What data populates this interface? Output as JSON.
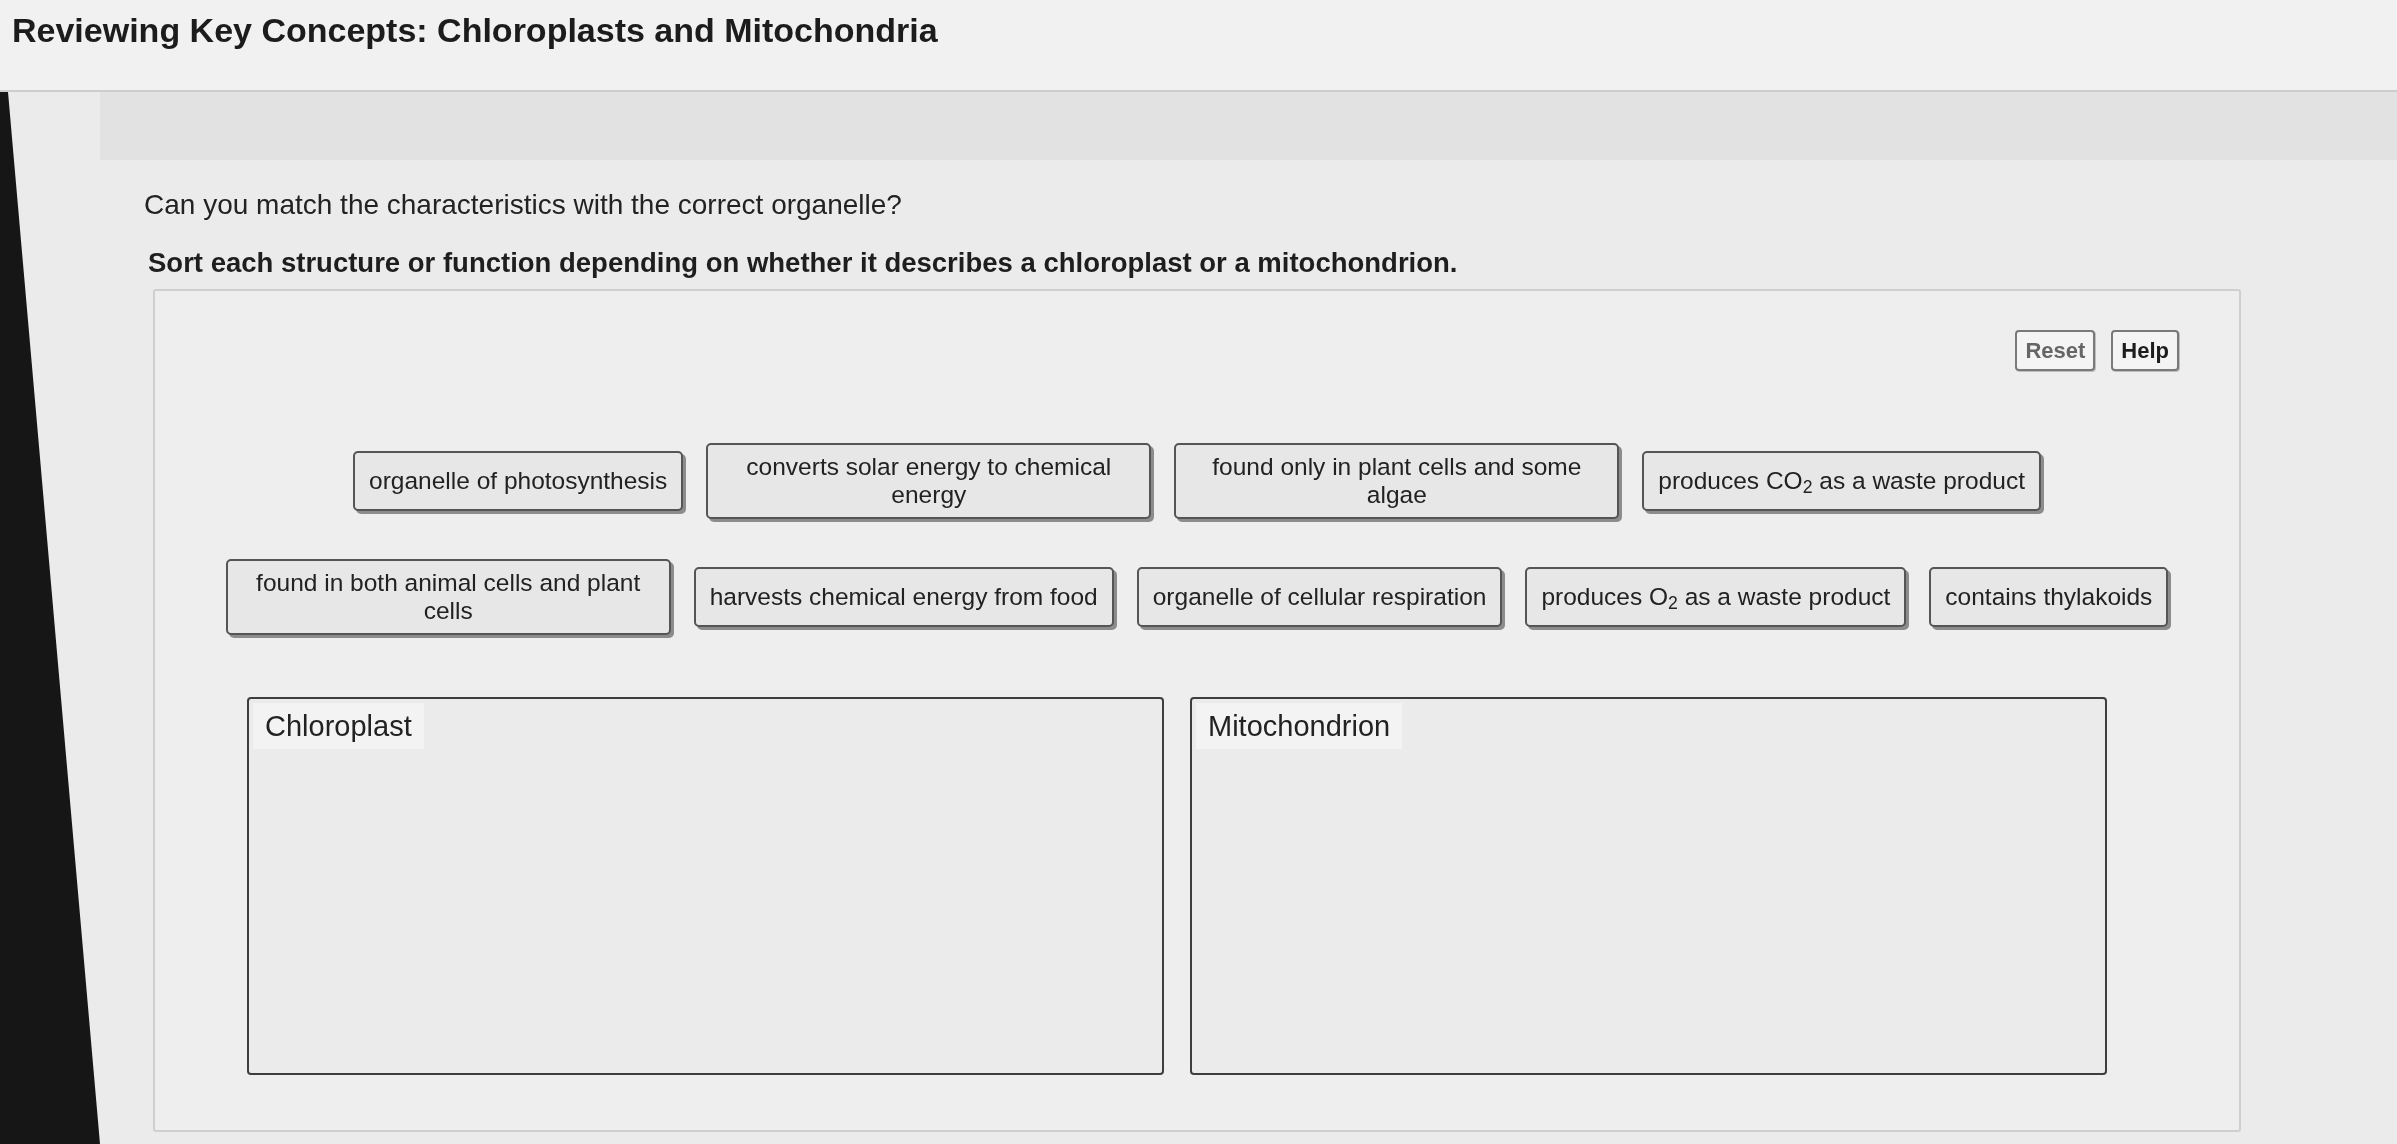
{
  "title": "Reviewing Key Concepts: Chloroplasts and Mitochondria",
  "question": "Can you match the characteristics with the correct organelle?",
  "instruction": "Sort each structure or function depending on whether it describes a chloroplast or a mitochondrion.",
  "buttons": [
    {
      "label": "Reset",
      "disabled": true
    },
    {
      "label": "Help",
      "disabled": false
    }
  ],
  "tiles": [
    "organelle of photosynthesis",
    "converts solar energy to chemical energy",
    "found only in plant cells and some algae",
    "produces CO$_{2}$ as a waste product",
    "found in both animal cells and plant cells",
    "harvests chemical energy from food",
    "organelle of cellular respiration",
    "produces O$_{2}$ as a waste product",
    "contains thylakoids"
  ],
  "bins": [
    {
      "label": "Chloroplast"
    },
    {
      "label": "Mitochondrion"
    }
  ]
}
